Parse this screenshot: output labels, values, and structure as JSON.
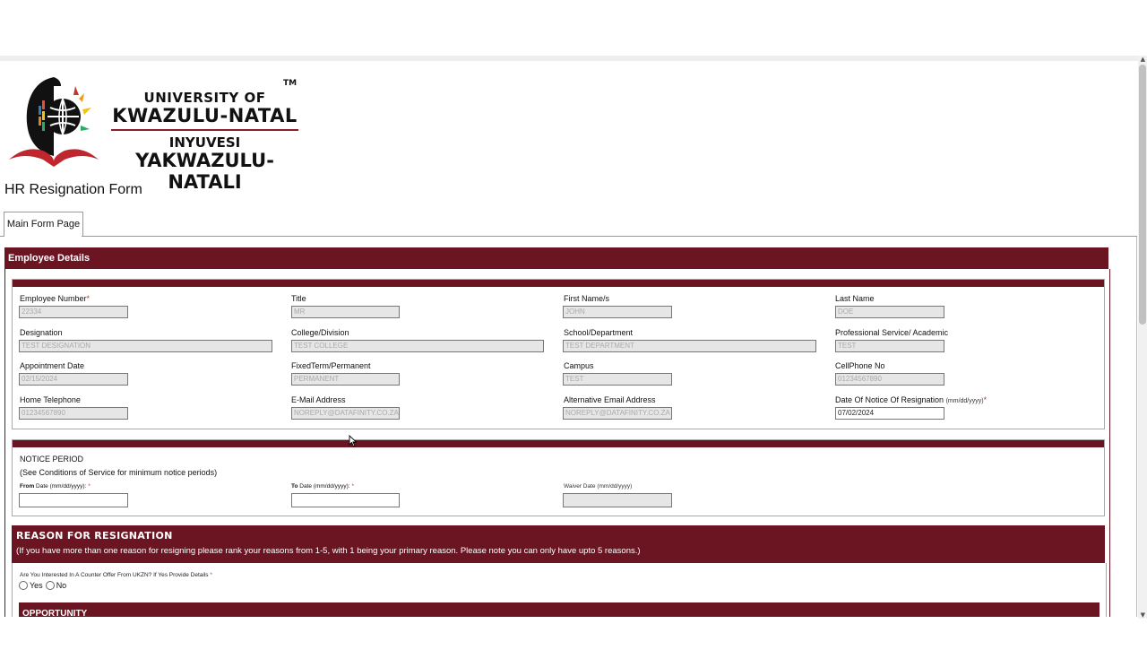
{
  "logo": {
    "line1": "UNIVERSITY OF",
    "line2": "KWAZULU-NATAL",
    "line3": "INYUVESI",
    "line4": "YAKWAZULU-NATALI",
    "tm": "TM"
  },
  "form_title": "HR Resignation Form",
  "tab": {
    "label": "Main Form Page"
  },
  "colors": {
    "accent": "#6b1522"
  },
  "employee_details": {
    "header": "Employee Details",
    "fields": {
      "employee_number": {
        "label": "Employee Number",
        "value": "22334",
        "required": "*"
      },
      "title": {
        "label": "Title",
        "value": "MR"
      },
      "first_names": {
        "label": "First Name/s",
        "value": "JOHN"
      },
      "last_name": {
        "label": "Last Name",
        "value": "DOE"
      },
      "designation": {
        "label": "Designation",
        "value": "TEST DESIGNATION"
      },
      "college": {
        "label": "College/Division",
        "value": "TEST COLLEGE"
      },
      "school": {
        "label": "School/Department",
        "value": "TEST DEPARTMENT"
      },
      "prof_service": {
        "label": "Professional Service/ Academic",
        "value": "TEST"
      },
      "appointment_date": {
        "label": "Appointment Date",
        "value": "02/15/2024"
      },
      "fixed_term": {
        "label": "FixedTerm/Permanent",
        "value": "PERMANENT"
      },
      "campus": {
        "label": "Campus",
        "value": "TEST"
      },
      "cellphone": {
        "label": "CellPhone No",
        "value": "01234567890"
      },
      "home_tel": {
        "label": "Home Telephone",
        "value": "01234567890"
      },
      "email": {
        "label": "E-Mail Address",
        "value": "NOREPLY@DATAFINITY.CO.ZA"
      },
      "alt_email": {
        "label": "Alternative Email Address",
        "value": "NOREPLY@DATAFINITY.CO.ZA"
      },
      "notice_date": {
        "label": "Date Of Notice Of Resignation",
        "hint": "(mm/dd/yyyy)",
        "value": "07/02/2024",
        "required": "*"
      }
    }
  },
  "notice_period": {
    "title": "NOTICE PERIOD",
    "subtitle": "(See Conditions of Service for minimum notice periods)",
    "from": {
      "label_bold": "From",
      "label_rest": " Date (mm/dd/yyyy):",
      "required": "*",
      "value": ""
    },
    "to": {
      "label_bold": "To",
      "label_rest": " Date (mm/dd/yyyy):",
      "required": "*",
      "value": ""
    },
    "waiver": {
      "label": "Waiver Date (mm/dd/yyyy)",
      "value": ""
    }
  },
  "reason": {
    "title": "REASON FOR RESIGNATION",
    "subtitle": "(If you have more than one reason for resigning please rank your reasons from 1-5, with 1 being your primary reason. Please note you can only have upto 5 reasons.)",
    "counter_offer_q": "Are You Interested In A Counter Offer From UKZN? If Yes Provide Details",
    "required": "*",
    "options": [
      "Yes",
      "No"
    ],
    "opportunity_header": "OPPORTUNITY"
  }
}
